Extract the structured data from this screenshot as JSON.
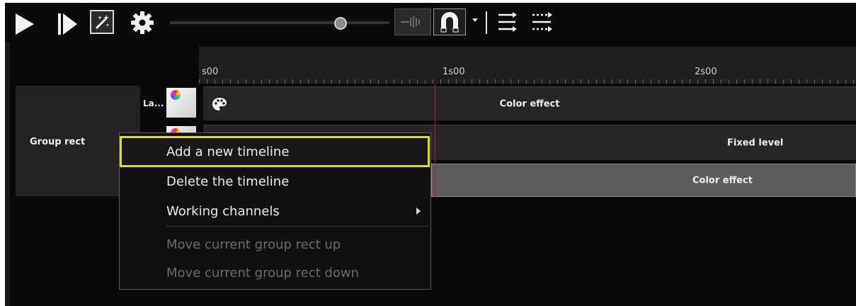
{
  "toolbar": {
    "icons": [
      "play-icon",
      "play-from-cursor-icon",
      "magic-wand-icon",
      "gear-icon",
      "slider",
      "snap-icon",
      "magnet-icon",
      "dropdown-arrow-icon",
      "align-left-icon",
      "align-dashed-icon"
    ]
  },
  "ruler": {
    "labels": [
      "s00",
      "1s00",
      "2s00"
    ]
  },
  "group": {
    "label": "Group rect",
    "layer_label": "La..."
  },
  "clips": [
    {
      "label": "Color effect"
    },
    {
      "label": "Fixed level"
    },
    {
      "label": "Color effect"
    }
  ],
  "context_menu": {
    "items": [
      {
        "label": "Add a new timeline",
        "enabled": true,
        "highlighted": true
      },
      {
        "label": "Delete the timeline",
        "enabled": true
      },
      {
        "label": "Working channels",
        "enabled": true,
        "has_submenu": true
      },
      {
        "label": "Move current group rect up",
        "enabled": false
      },
      {
        "label": "Move current group rect down",
        "enabled": false
      }
    ]
  },
  "colors": {
    "background": "#0a0a0a",
    "highlight_border": "#d6e02a",
    "playhead": "#c4161c",
    "selected_clip": "#5d5d5d"
  }
}
